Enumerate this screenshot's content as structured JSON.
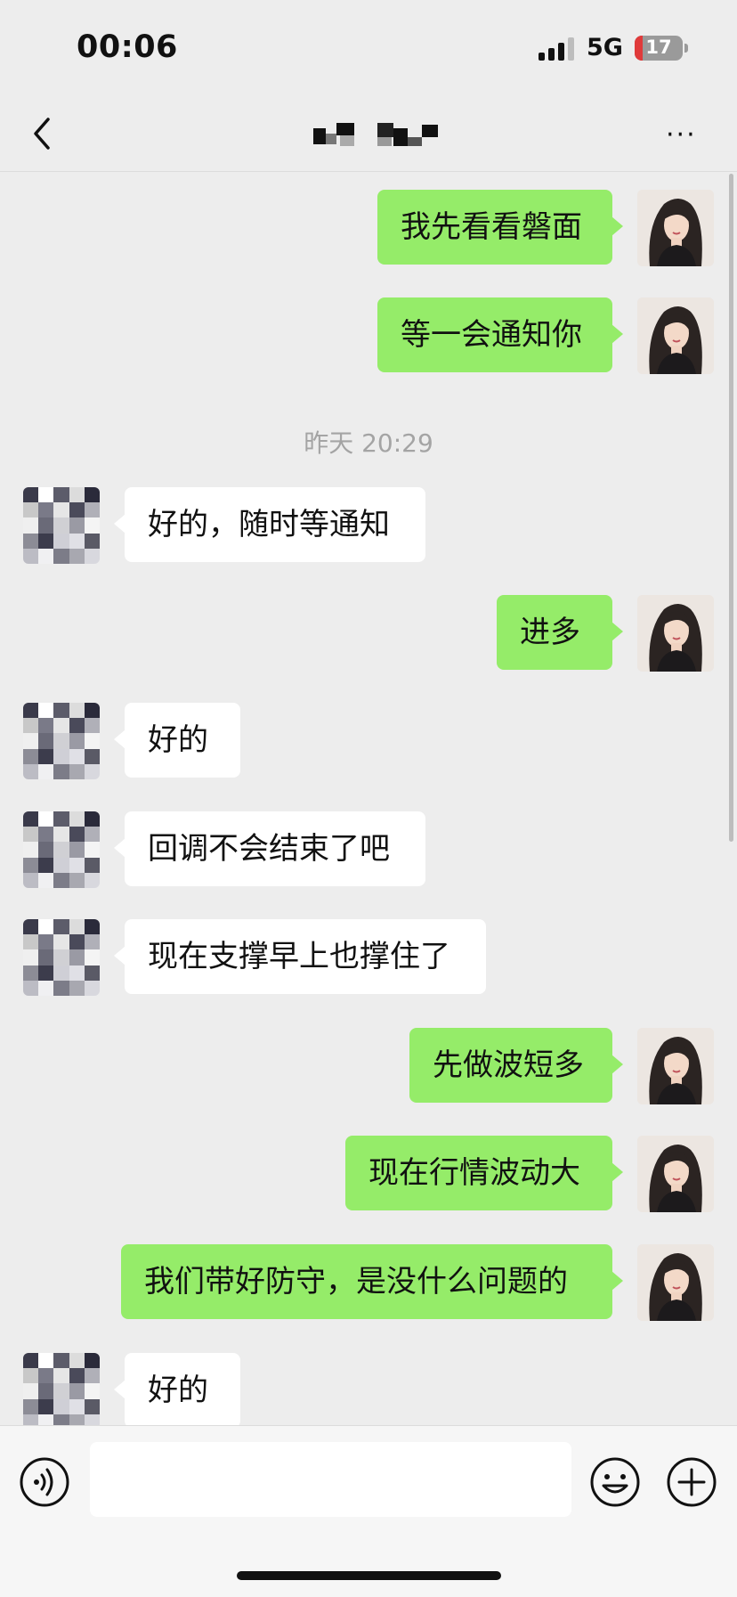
{
  "status_bar": {
    "time": "00:06",
    "network": "5G",
    "battery_level": "17",
    "battery_fraction": 0.17
  },
  "nav": {
    "back_icon": "chevron-left-icon",
    "more_icon": "more-dots-icon",
    "more_label": "···"
  },
  "messages": [
    {
      "sender": "me",
      "text": "我先看看磐面"
    },
    {
      "sender": "me",
      "text": "等一会通知你"
    },
    {
      "type": "time",
      "text": "昨天 20:29"
    },
    {
      "sender": "other",
      "text": "好的，随时等通知"
    },
    {
      "sender": "me",
      "text": "进多"
    },
    {
      "sender": "other",
      "text": "好的"
    },
    {
      "sender": "other",
      "text": "回调不会结束了吧"
    },
    {
      "sender": "other",
      "text": "现在支撑早上也撑住了"
    },
    {
      "sender": "me",
      "text": "先做波短多"
    },
    {
      "sender": "me",
      "text": "现在行情波动大"
    },
    {
      "sender": "me",
      "text": "我们带好防守，是没什么问题的"
    },
    {
      "sender": "other",
      "text": "好的"
    }
  ],
  "input_bar": {
    "voice_icon": "voice-icon",
    "emoji_icon": "emoji-icon",
    "plus_icon": "plus-icon"
  },
  "colors": {
    "my_bubble": "#95ec69",
    "their_bubble": "#ffffff",
    "background": "#ededed",
    "battery_low": "#e03a3a"
  }
}
